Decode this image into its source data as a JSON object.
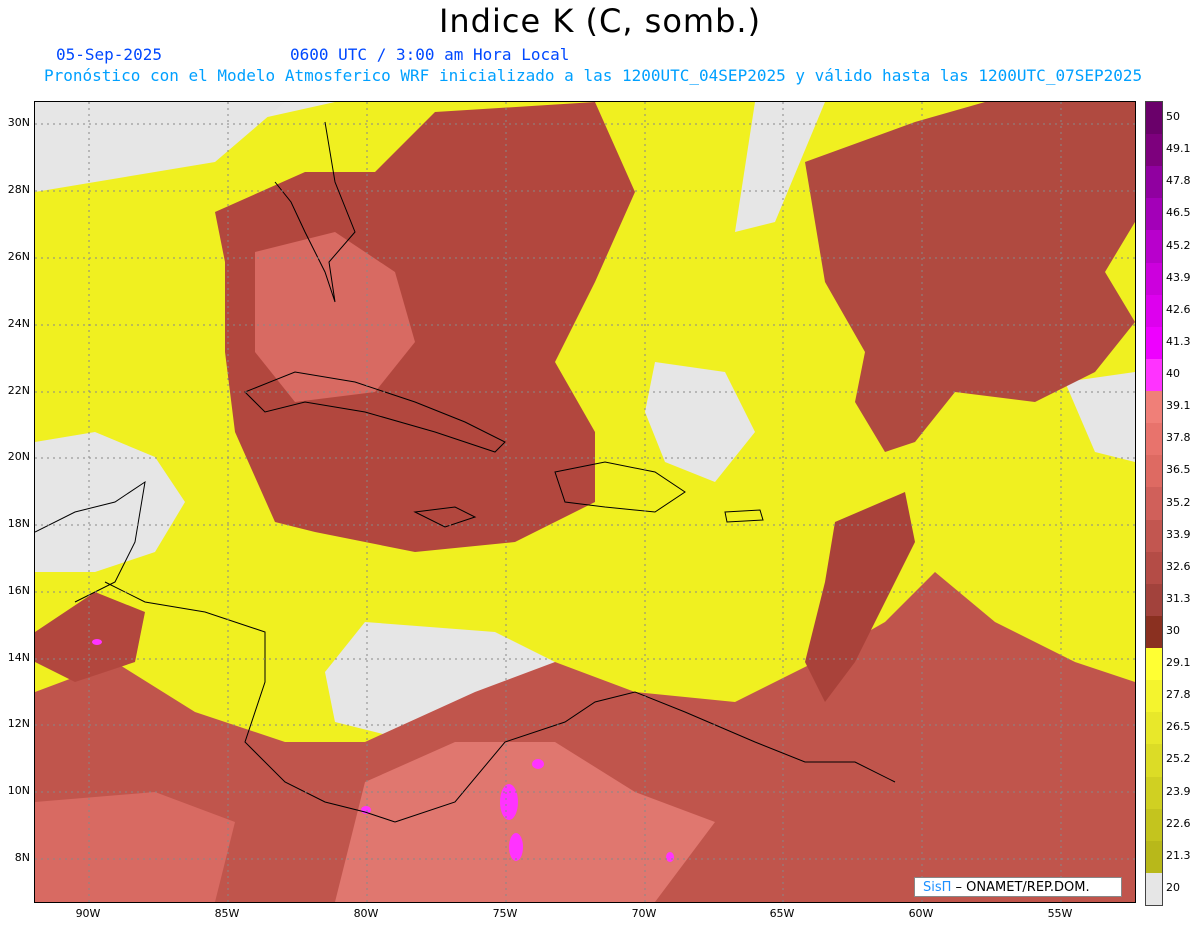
{
  "title": "Indice K (C, somb.)",
  "date": "05-Sep-2025",
  "valid_time": "0600 UTC / 3:00 am Hora Local",
  "forecast_note": "Pronóstico con el Modelo Atmosferico WRF inicializado a las 1200UTC_04SEP2025 y válido hasta las  1200UTC_07SEP2025",
  "credit": {
    "brand": "SisΠ",
    "text": " – ONAMET/REP.DOM."
  },
  "lat_labels": [
    "30N",
    "28N",
    "26N",
    "24N",
    "22N",
    "20N",
    "18N",
    "16N",
    "14N",
    "12N",
    "10N",
    "8N"
  ],
  "lon_labels": [
    "90W",
    "85W",
    "80W",
    "75W",
    "70W",
    "65W",
    "60W",
    "55W"
  ],
  "colorbar": {
    "labels": [
      "50",
      "49.1",
      "47.8",
      "46.5",
      "45.2",
      "43.9",
      "42.6",
      "41.3",
      "40",
      "39.1",
      "37.8",
      "36.5",
      "35.2",
      "33.9",
      "32.6",
      "31.3",
      "30",
      "29.1",
      "27.8",
      "26.5",
      "25.2",
      "23.9",
      "22.6",
      "21.3",
      "20"
    ],
    "colors": [
      "#6a006a",
      "#7d007d",
      "#9000a0",
      "#a300b8",
      "#b800cc",
      "#cc00dd",
      "#dd00ee",
      "#ee00ff",
      "#ff33ff",
      "#f07f78",
      "#e8736c",
      "#de6a62",
      "#d0605a",
      "#c25650",
      "#b44c46",
      "#a2423c",
      "#8a3020",
      "#ffff33",
      "#f4f42e",
      "#e8e82a",
      "#dcdc26",
      "#d0d022",
      "#c4c41e",
      "#b8b81a",
      "#e6e6e6"
    ]
  }
}
